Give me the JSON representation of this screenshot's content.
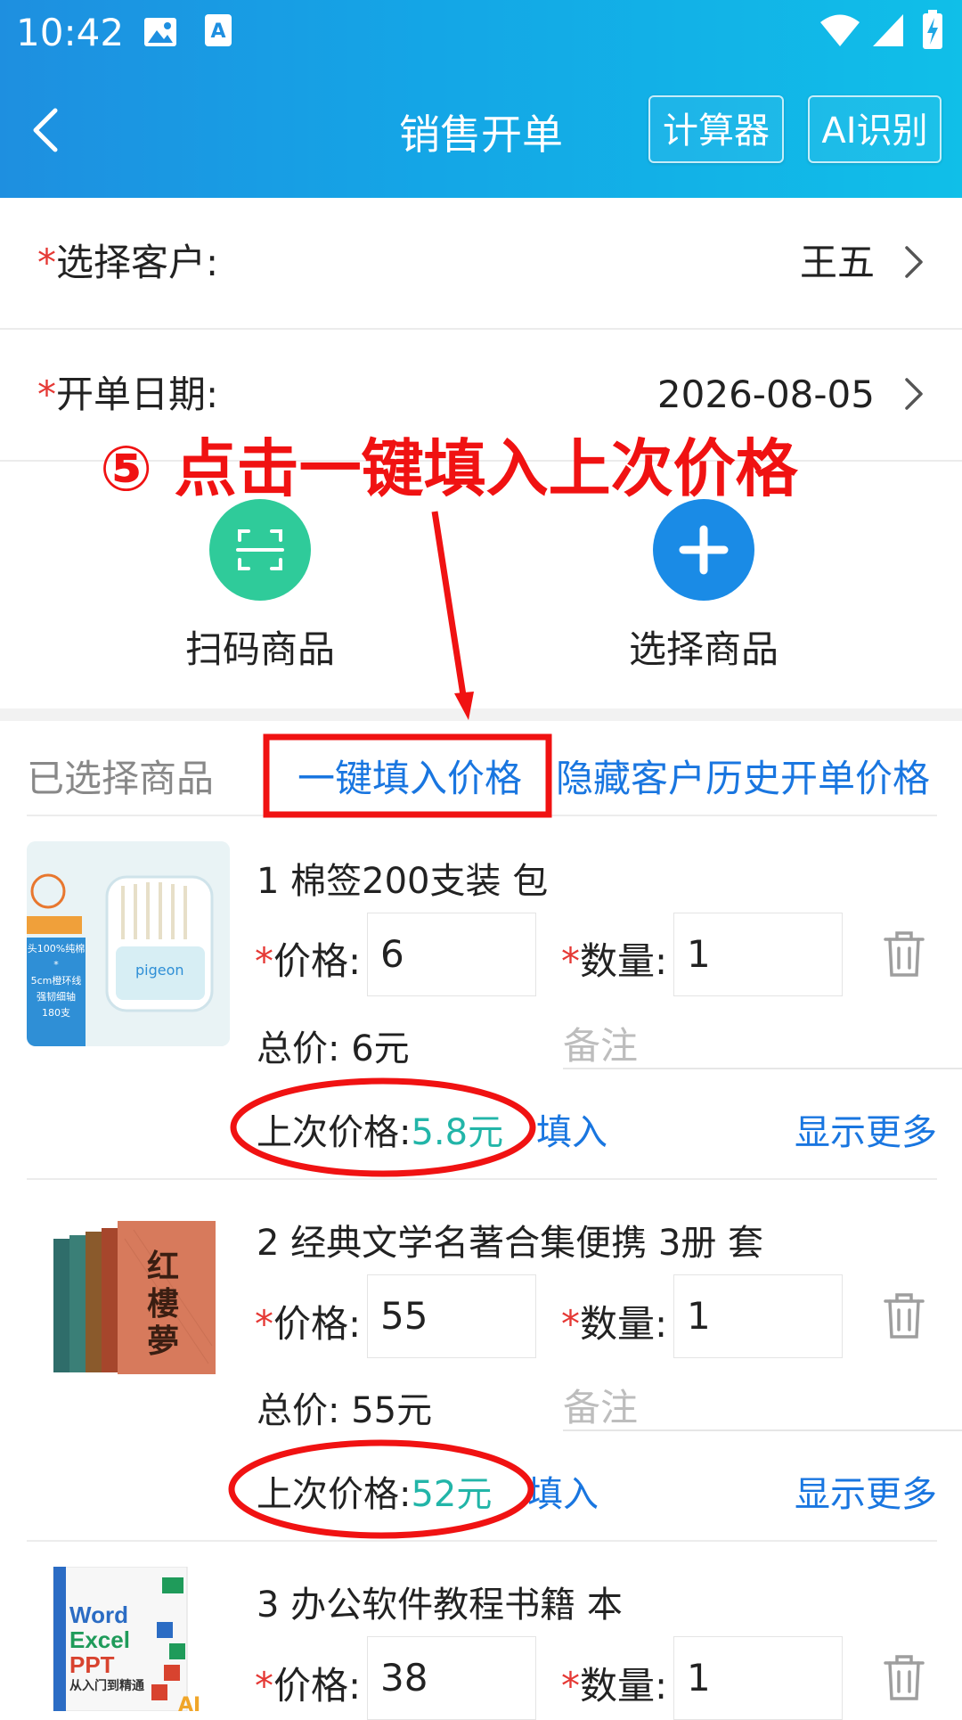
{
  "status_bar": {
    "time": "10:42"
  },
  "header": {
    "title": "销售开单",
    "calculator_label": "计算器",
    "ai_label": "AI识别"
  },
  "form": {
    "customer_label": "选择客户:",
    "customer_value": "王五",
    "date_label": "开单日期:",
    "date_value": "2026-08-05",
    "required_mark": "*"
  },
  "annotation": {
    "text": "⑤ 点击一键填入上次价格"
  },
  "actions": {
    "scan_label": "扫码商品",
    "select_label": "选择商品"
  },
  "selected": {
    "title": "已选择商品",
    "fill_all_label": "一键填入价格",
    "hide_history_label": "隐藏客户历史开单价格"
  },
  "labels": {
    "price": "价格:",
    "qty": "数量:",
    "total_prefix": "总价: ",
    "note_placeholder": "备注",
    "last_price": "上次价格:",
    "fill": "填入",
    "show_more": "显示更多"
  },
  "products": [
    {
      "name": "1 棉签200支装 包",
      "price": "6",
      "qty": "1",
      "total": "6元",
      "last_price": "5.8元",
      "thumb_lines": [
        "头100%纯棉*",
        "5cm橙环线",
        "强韧细轴",
        "180支"
      ]
    },
    {
      "name": "2 经典文学名著合集便携 3册 套",
      "price": "55",
      "qty": "1",
      "total": "55元",
      "last_price": "52元",
      "thumb_title": "红樓夢"
    },
    {
      "name": "3 办公软件教程书籍 本",
      "price": "38",
      "qty": "1",
      "thumb_lines": [
        "Word",
        "Excel",
        "PPT",
        "从入门到精通"
      ]
    }
  ],
  "colors": {
    "header_gradient_start": "#1e8fe0",
    "header_gradient_end": "#10bfe8",
    "link": "#1976e0",
    "last_price": "#22b5a8",
    "annotation": "#f01212",
    "scan_circle": "#2fcb9a",
    "select_circle": "#1a8be6"
  }
}
